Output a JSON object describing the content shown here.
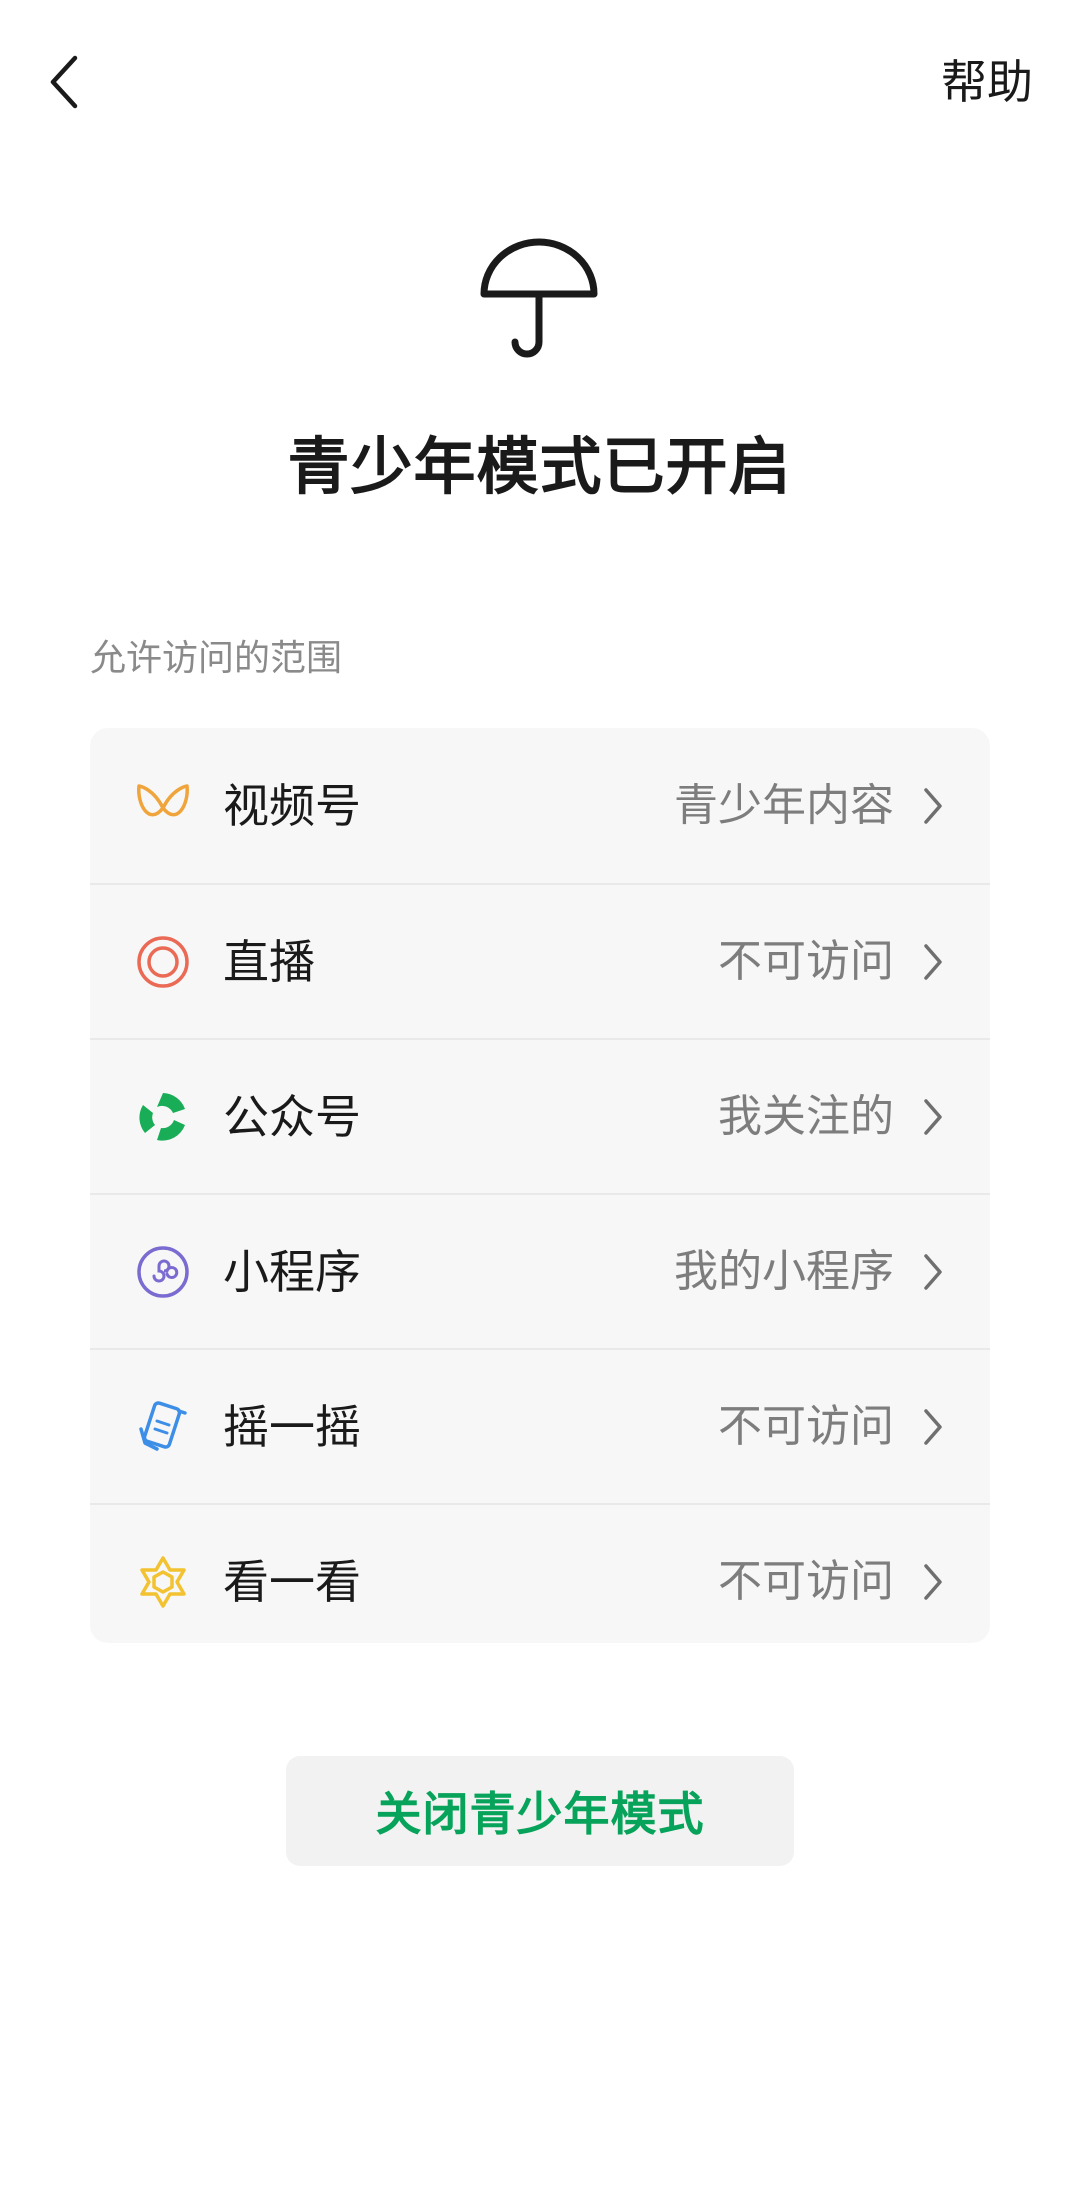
{
  "nav": {
    "help_label": "帮助"
  },
  "hero": {
    "title": "青少年模式已开启"
  },
  "section": {
    "label": "允许访问的范围"
  },
  "items": [
    {
      "label": "视频号",
      "value": "青少年内容",
      "icon": "channels-icon",
      "color": "#f0a43c"
    },
    {
      "label": "直播",
      "value": "不可访问",
      "icon": "live-icon",
      "color": "#ea6a55"
    },
    {
      "label": "公众号",
      "value": "我关注的",
      "icon": "official-accounts-icon",
      "color": "#1aad57"
    },
    {
      "label": "小程序",
      "value": "我的小程序",
      "icon": "mini-program-icon",
      "color": "#7a6bd1"
    },
    {
      "label": "摇一摇",
      "value": "不可访问",
      "icon": "shake-icon",
      "color": "#3d8ee6"
    },
    {
      "label": "看一看",
      "value": "不可访问",
      "icon": "top-stories-icon",
      "color": "#f2c230"
    }
  ],
  "actions": {
    "close_label": "关闭青少年模式"
  },
  "colors": {
    "accent_green": "#07a35a",
    "card_bg": "#f7f7f7",
    "secondary_text": "#7d7d7d"
  }
}
